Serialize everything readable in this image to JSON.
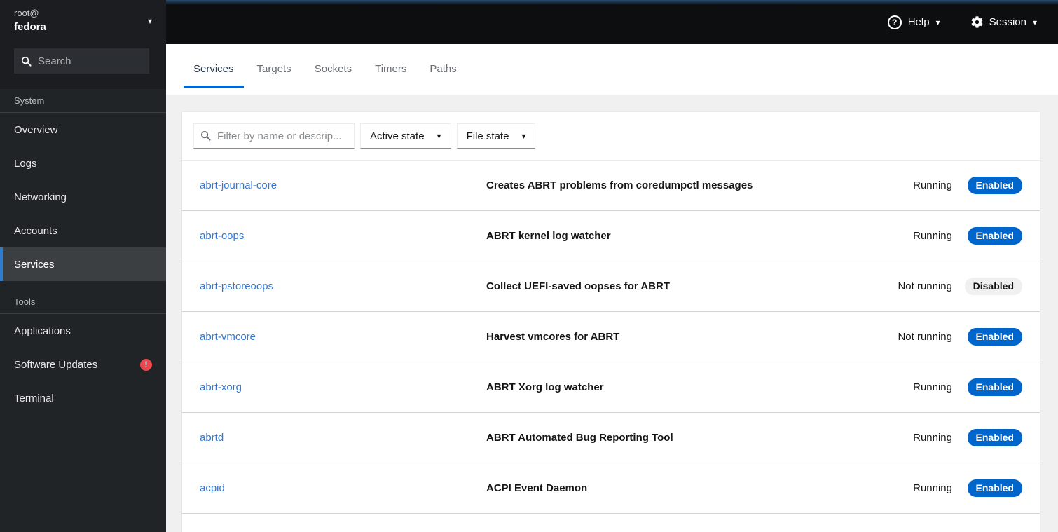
{
  "session": {
    "user": "root@",
    "host": "fedora"
  },
  "icons": {
    "help": "?",
    "caret": "▾",
    "exclamation": "!"
  },
  "sidebar": {
    "search_placeholder": "Search",
    "sections": [
      {
        "label": "System",
        "items": [
          {
            "label": "Overview"
          },
          {
            "label": "Logs"
          },
          {
            "label": "Networking"
          },
          {
            "label": "Accounts"
          },
          {
            "label": "Services",
            "selected": true
          }
        ]
      },
      {
        "label": "Tools",
        "items": [
          {
            "label": "Applications"
          },
          {
            "label": "Software Updates",
            "badge": "!"
          },
          {
            "label": "Terminal"
          }
        ]
      }
    ]
  },
  "masthead": {
    "help_label": "Help",
    "session_label": "Session"
  },
  "tabs": [
    {
      "label": "Services",
      "active": true
    },
    {
      "label": "Targets"
    },
    {
      "label": "Sockets"
    },
    {
      "label": "Timers"
    },
    {
      "label": "Paths"
    }
  ],
  "toolbar": {
    "filter_placeholder": "Filter by name or descrip...",
    "active_state_label": "Active state",
    "file_state_label": "File state"
  },
  "services": [
    {
      "name": "abrt-journal-core",
      "description": "Creates ABRT problems from coredumpctl messages",
      "state": "Running",
      "file_state": "Enabled",
      "enabled": true
    },
    {
      "name": "abrt-oops",
      "description": "ABRT kernel log watcher",
      "state": "Running",
      "file_state": "Enabled",
      "enabled": true
    },
    {
      "name": "abrt-pstoreoops",
      "description": "Collect UEFI-saved oopses for ABRT",
      "state": "Not running",
      "file_state": "Disabled",
      "enabled": false
    },
    {
      "name": "abrt-vmcore",
      "description": "Harvest vmcores for ABRT",
      "state": "Not running",
      "file_state": "Enabled",
      "enabled": true
    },
    {
      "name": "abrt-xorg",
      "description": "ABRT Xorg log watcher",
      "state": "Running",
      "file_state": "Enabled",
      "enabled": true
    },
    {
      "name": "abrtd",
      "description": "ABRT Automated Bug Reporting Tool",
      "state": "Running",
      "file_state": "Enabled",
      "enabled": true
    },
    {
      "name": "acpid",
      "description": "ACPI Event Daemon",
      "state": "Running",
      "file_state": "Enabled",
      "enabled": true
    }
  ],
  "colors": {
    "accent_blue": "#0066cc",
    "link_blue": "#3477d1",
    "enabled_badge_bg": "#0066cc",
    "disabled_badge_bg": "#f0f0f0",
    "selected_nav_border": "#2e7dd1",
    "alert_red": "#e8484d",
    "masthead_bg": "#0d0e10",
    "sidebar_bg": "#212427",
    "sidebar_header_bg": "#1b1d21",
    "page_bg": "#f0f0f0"
  }
}
